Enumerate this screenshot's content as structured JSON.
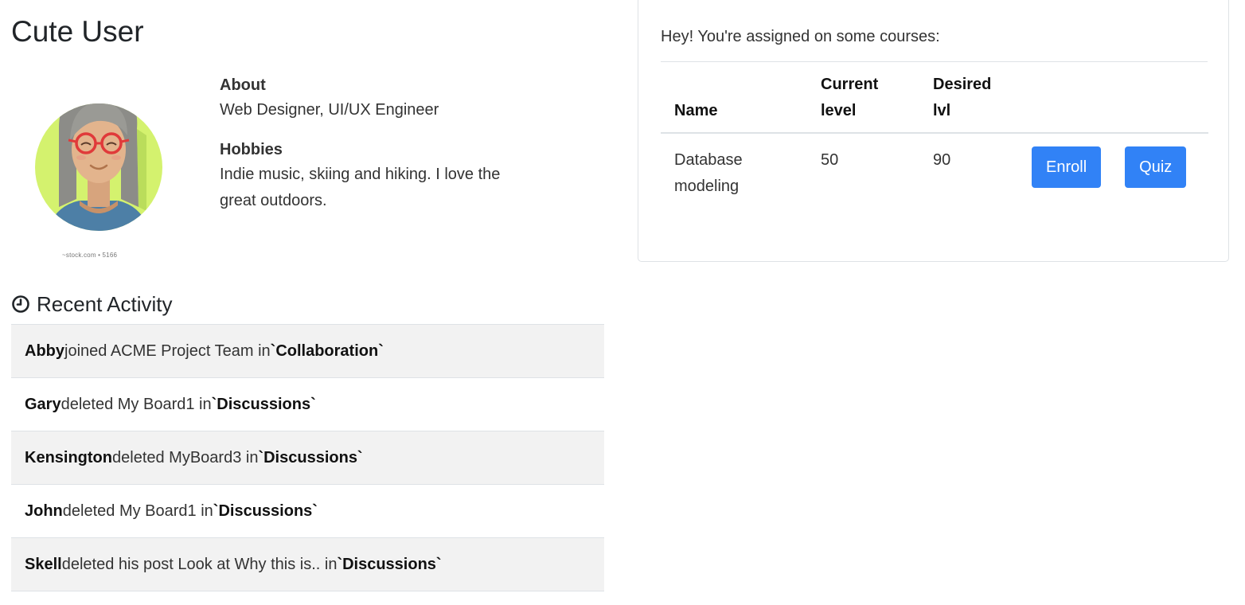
{
  "profile": {
    "name": "Cute User",
    "avatar_credit": "~stock.com • 5166",
    "about_label": "About",
    "about_text": "Web Designer, UI/UX Engineer",
    "hobbies_label": "Hobbies",
    "hobbies_text": "Indie music, skiing and hiking. I love the great outdoors."
  },
  "activity": {
    "heading": "Recent Activity",
    "icon": "clock-icon",
    "items": [
      {
        "user": "Abby",
        "action": " joined ACME Project Team in ",
        "target": "`Collaboration`"
      },
      {
        "user": "Gary",
        "action": " deleted My Board1 in ",
        "target": "`Discussions`"
      },
      {
        "user": "Kensington",
        "action": " deleted MyBoard3 in ",
        "target": "`Discussions`"
      },
      {
        "user": "John",
        "action": " deleted My Board1 in ",
        "target": "`Discussions`"
      },
      {
        "user": "Skell",
        "action": " deleted his post Look at Why this is.. in ",
        "target": "`Discussions`"
      }
    ]
  },
  "courses": {
    "intro": "Hey! You're assigned on some courses:",
    "columns": {
      "name": "Name",
      "current": "Current level",
      "desired": "Desired lvl"
    },
    "rows": [
      {
        "name": "Database modeling",
        "current": "50",
        "desired": "90",
        "enroll_label": "Enroll",
        "quiz_label": "Quiz"
      }
    ]
  },
  "colors": {
    "button": "#3182f6",
    "row_stripe": "#f2f2f2",
    "border": "#dee2e6"
  }
}
